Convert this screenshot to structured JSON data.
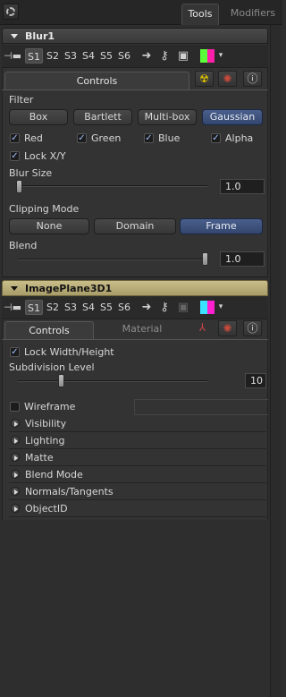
{
  "top_tabs": [
    {
      "label": "Tools"
    },
    {
      "label": "Modifiers"
    }
  ],
  "blur": {
    "title": "Blur1",
    "slots": [
      "S1",
      "S2",
      "S3",
      "S4",
      "S5",
      "S6"
    ],
    "tab_controls": "Controls",
    "filter_label": "Filter",
    "filter_options": [
      "Box",
      "Bartlett",
      "Multi-box",
      "Gaussian"
    ],
    "filter_selected": "Gaussian",
    "channels": [
      {
        "label": "Red",
        "checked": true
      },
      {
        "label": "Green",
        "checked": true
      },
      {
        "label": "Blue",
        "checked": true
      },
      {
        "label": "Alpha",
        "checked": true
      }
    ],
    "lock_xy": {
      "label": "Lock X/Y",
      "checked": true
    },
    "blur_size": {
      "label": "Blur Size",
      "value": "1.0",
      "fraction": 0.0
    },
    "clipping_label": "Clipping Mode",
    "clipping_options": [
      "None",
      "Domain",
      "Frame"
    ],
    "clipping_selected": "Frame",
    "blend": {
      "label": "Blend",
      "value": "1.0",
      "fraction": 1.0
    }
  },
  "imageplane": {
    "title": "ImagePlane3D1",
    "slots": [
      "S1",
      "S2",
      "S3",
      "S4",
      "S5",
      "S6"
    ],
    "tabs": [
      "Controls",
      "Material"
    ],
    "lock_wh": {
      "label": "Lock Width/Height",
      "checked": true
    },
    "subdivision": {
      "label": "Subdivision Level",
      "value": "10",
      "fraction": 0.18
    },
    "wireframe": {
      "label": "Wireframe",
      "checked": false
    },
    "groups": [
      "Visibility",
      "Lighting",
      "Matte",
      "Blend Mode",
      "Normals/Tangents",
      "ObjectID"
    ]
  },
  "colors": {
    "accent": "#3f5283",
    "header_gold": "#b8ac78",
    "bg": "#2e2e2e"
  }
}
